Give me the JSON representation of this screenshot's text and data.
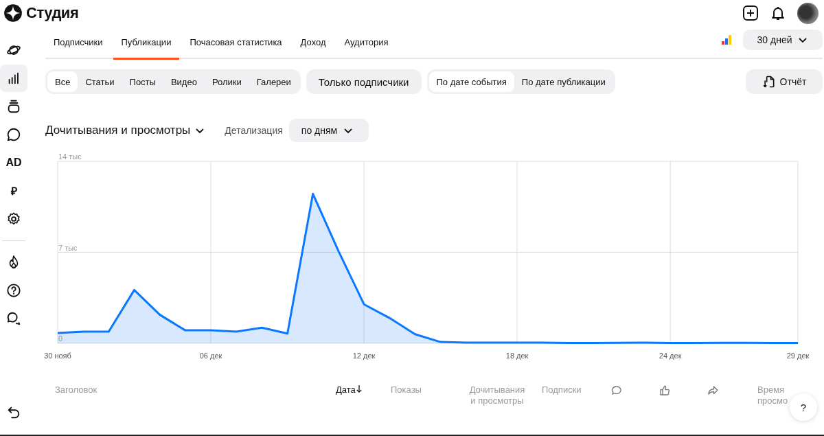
{
  "header": {
    "logo": "Студия"
  },
  "sidebar": {
    "items": [
      {
        "selected": false
      },
      {
        "selected": true
      },
      {
        "selected": false
      },
      {
        "selected": false
      },
      {
        "selected": false,
        "label": "AD"
      },
      {
        "selected": false,
        "label": "₽"
      },
      {
        "selected": false
      },
      {
        "selected": false
      },
      {
        "selected": false
      },
      {
        "selected": false
      }
    ]
  },
  "tabs": [
    {
      "label": "Подписчики",
      "selected": false
    },
    {
      "label": "Публикации",
      "selected": true
    },
    {
      "label": "Почасовая статистика",
      "selected": false
    },
    {
      "label": "Доход",
      "selected": false
    },
    {
      "label": "Аудитория",
      "selected": false
    }
  ],
  "period": {
    "value": "30 дней"
  },
  "content_filters": [
    {
      "label": "Все",
      "selected": true
    },
    {
      "label": "Статьи",
      "selected": false
    },
    {
      "label": "Посты",
      "selected": false
    },
    {
      "label": "Видео",
      "selected": false
    },
    {
      "label": "Ролики",
      "selected": false
    },
    {
      "label": "Галереи",
      "selected": false
    }
  ],
  "subscribers_filter": {
    "label": "Только подписчики",
    "selected": false
  },
  "date_modes": [
    {
      "label": "По дате события",
      "selected": true
    },
    {
      "label": "По дате публикации",
      "selected": false
    }
  ],
  "report_button": "Отчёт",
  "metric": {
    "label": "Дочитывания и просмотры",
    "detail_label": "Детализация",
    "detail_value": "по дням"
  },
  "chart_data": {
    "type": "area",
    "categories": [
      "30 нояб",
      null,
      null,
      null,
      null,
      null,
      "06 дек",
      null,
      null,
      null,
      null,
      null,
      "12 дек",
      null,
      null,
      null,
      null,
      null,
      "18 дек",
      null,
      null,
      null,
      null,
      null,
      "24 дек",
      null,
      null,
      null,
      null,
      "29 дек"
    ],
    "grid": true,
    "series": [
      {
        "color": "#0a78ff",
        "values": [
          0.8,
          0.9,
          0.9,
          4.1,
          2.2,
          1.0,
          1.0,
          0.9,
          1.2,
          0.75,
          11.5,
          7.1,
          3.0,
          1.95,
          0.7,
          0.1,
          0.06,
          0.06,
          0.06,
          0.05,
          0.03,
          0.03,
          0.04,
          0.05,
          0.03,
          0.03,
          0.04,
          0.04,
          0.03,
          0.03
        ]
      }
    ],
    "ylim": [
      0,
      14
    ],
    "yticks": [
      {
        "value": 0,
        "label": "0"
      },
      {
        "value": 7,
        "label": "7 тыс"
      },
      {
        "value": 14,
        "label": "14 тыс"
      }
    ]
  },
  "table": {
    "columns": [
      {
        "kind": "text",
        "label": "Заголовок",
        "sorted": false
      },
      {
        "kind": "text",
        "label": "Дата",
        "sorted": true
      },
      {
        "kind": "text",
        "label": "Показы",
        "sorted": false
      },
      {
        "kind": "text",
        "label": "Дочитывания и просмотры",
        "sorted": false
      },
      {
        "kind": "text",
        "label": "Подписки",
        "sorted": false
      },
      {
        "kind": "icon"
      },
      {
        "kind": "icon"
      },
      {
        "kind": "icon"
      },
      {
        "kind": "text",
        "label": "Время просмо",
        "sorted": false
      }
    ]
  },
  "help_button": "?"
}
